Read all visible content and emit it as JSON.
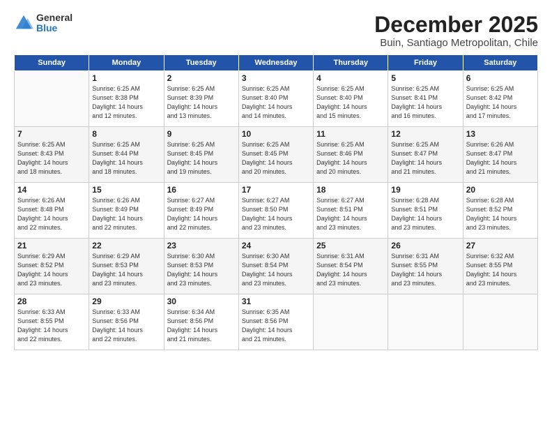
{
  "logo": {
    "general": "General",
    "blue": "Blue"
  },
  "title": "December 2025",
  "subtitle": "Buin, Santiago Metropolitan, Chile",
  "days_of_week": [
    "Sunday",
    "Monday",
    "Tuesday",
    "Wednesday",
    "Thursday",
    "Friday",
    "Saturday"
  ],
  "weeks": [
    [
      {
        "day": "",
        "info": ""
      },
      {
        "day": "1",
        "info": "Sunrise: 6:25 AM\nSunset: 8:38 PM\nDaylight: 14 hours\nand 12 minutes."
      },
      {
        "day": "2",
        "info": "Sunrise: 6:25 AM\nSunset: 8:39 PM\nDaylight: 14 hours\nand 13 minutes."
      },
      {
        "day": "3",
        "info": "Sunrise: 6:25 AM\nSunset: 8:40 PM\nDaylight: 14 hours\nand 14 minutes."
      },
      {
        "day": "4",
        "info": "Sunrise: 6:25 AM\nSunset: 8:40 PM\nDaylight: 14 hours\nand 15 minutes."
      },
      {
        "day": "5",
        "info": "Sunrise: 6:25 AM\nSunset: 8:41 PM\nDaylight: 14 hours\nand 16 minutes."
      },
      {
        "day": "6",
        "info": "Sunrise: 6:25 AM\nSunset: 8:42 PM\nDaylight: 14 hours\nand 17 minutes."
      }
    ],
    [
      {
        "day": "7",
        "info": "Sunrise: 6:25 AM\nSunset: 8:43 PM\nDaylight: 14 hours\nand 18 minutes."
      },
      {
        "day": "8",
        "info": "Sunrise: 6:25 AM\nSunset: 8:44 PM\nDaylight: 14 hours\nand 18 minutes."
      },
      {
        "day": "9",
        "info": "Sunrise: 6:25 AM\nSunset: 8:45 PM\nDaylight: 14 hours\nand 19 minutes."
      },
      {
        "day": "10",
        "info": "Sunrise: 6:25 AM\nSunset: 8:45 PM\nDaylight: 14 hours\nand 20 minutes."
      },
      {
        "day": "11",
        "info": "Sunrise: 6:25 AM\nSunset: 8:46 PM\nDaylight: 14 hours\nand 20 minutes."
      },
      {
        "day": "12",
        "info": "Sunrise: 6:25 AM\nSunset: 8:47 PM\nDaylight: 14 hours\nand 21 minutes."
      },
      {
        "day": "13",
        "info": "Sunrise: 6:26 AM\nSunset: 8:47 PM\nDaylight: 14 hours\nand 21 minutes."
      }
    ],
    [
      {
        "day": "14",
        "info": "Sunrise: 6:26 AM\nSunset: 8:48 PM\nDaylight: 14 hours\nand 22 minutes."
      },
      {
        "day": "15",
        "info": "Sunrise: 6:26 AM\nSunset: 8:49 PM\nDaylight: 14 hours\nand 22 minutes."
      },
      {
        "day": "16",
        "info": "Sunrise: 6:27 AM\nSunset: 8:49 PM\nDaylight: 14 hours\nand 22 minutes."
      },
      {
        "day": "17",
        "info": "Sunrise: 6:27 AM\nSunset: 8:50 PM\nDaylight: 14 hours\nand 23 minutes."
      },
      {
        "day": "18",
        "info": "Sunrise: 6:27 AM\nSunset: 8:51 PM\nDaylight: 14 hours\nand 23 minutes."
      },
      {
        "day": "19",
        "info": "Sunrise: 6:28 AM\nSunset: 8:51 PM\nDaylight: 14 hours\nand 23 minutes."
      },
      {
        "day": "20",
        "info": "Sunrise: 6:28 AM\nSunset: 8:52 PM\nDaylight: 14 hours\nand 23 minutes."
      }
    ],
    [
      {
        "day": "21",
        "info": "Sunrise: 6:29 AM\nSunset: 8:52 PM\nDaylight: 14 hours\nand 23 minutes."
      },
      {
        "day": "22",
        "info": "Sunrise: 6:29 AM\nSunset: 8:53 PM\nDaylight: 14 hours\nand 23 minutes."
      },
      {
        "day": "23",
        "info": "Sunrise: 6:30 AM\nSunset: 8:53 PM\nDaylight: 14 hours\nand 23 minutes."
      },
      {
        "day": "24",
        "info": "Sunrise: 6:30 AM\nSunset: 8:54 PM\nDaylight: 14 hours\nand 23 minutes."
      },
      {
        "day": "25",
        "info": "Sunrise: 6:31 AM\nSunset: 8:54 PM\nDaylight: 14 hours\nand 23 minutes."
      },
      {
        "day": "26",
        "info": "Sunrise: 6:31 AM\nSunset: 8:55 PM\nDaylight: 14 hours\nand 23 minutes."
      },
      {
        "day": "27",
        "info": "Sunrise: 6:32 AM\nSunset: 8:55 PM\nDaylight: 14 hours\nand 23 minutes."
      }
    ],
    [
      {
        "day": "28",
        "info": "Sunrise: 6:33 AM\nSunset: 8:55 PM\nDaylight: 14 hours\nand 22 minutes."
      },
      {
        "day": "29",
        "info": "Sunrise: 6:33 AM\nSunset: 8:56 PM\nDaylight: 14 hours\nand 22 minutes."
      },
      {
        "day": "30",
        "info": "Sunrise: 6:34 AM\nSunset: 8:56 PM\nDaylight: 14 hours\nand 21 minutes."
      },
      {
        "day": "31",
        "info": "Sunrise: 6:35 AM\nSunset: 8:56 PM\nDaylight: 14 hours\nand 21 minutes."
      },
      {
        "day": "",
        "info": ""
      },
      {
        "day": "",
        "info": ""
      },
      {
        "day": "",
        "info": ""
      }
    ]
  ]
}
